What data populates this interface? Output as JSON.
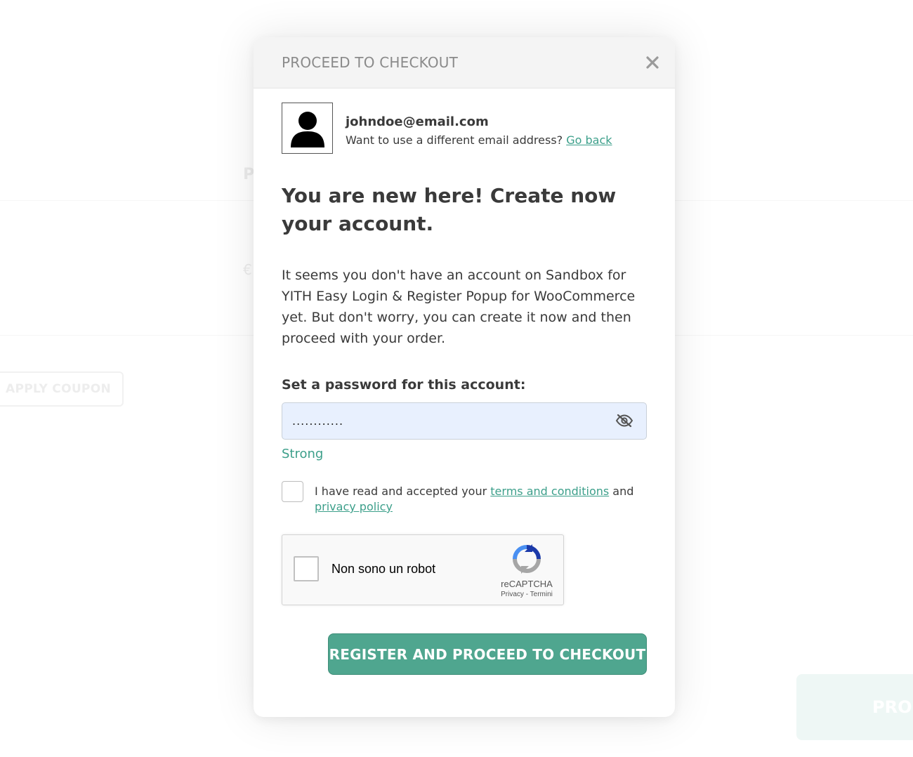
{
  "background": {
    "letter_p": "P",
    "currency_symbol": "€",
    "apply_coupon_label": "APPLY COUPON",
    "proceed_partial_label": "PRO"
  },
  "modal": {
    "title": "PROCEED TO CHECKOUT",
    "close_icon": "close-icon",
    "user": {
      "avatar_icon": "user-avatar-icon",
      "email": "johndoe@email.com",
      "alt_prompt": "Want to use a different email address?",
      "go_back_label": "Go back"
    },
    "headline": "You are new here! Create now your account.",
    "description": "It seems you don't have an account on Sandbox for YITH Easy Login & Register Popup for WooCommerce yet. But don't worry, you can create it now and then proceed with your order.",
    "password": {
      "label": "Set a password for this account:",
      "value": "............",
      "toggle_icon": "eye-slash-icon",
      "strength": "Strong"
    },
    "terms": {
      "prefix": "I have read and accepted your",
      "terms_link": "terms and conditions",
      "and_word": "and",
      "privacy_link": "privacy policy",
      "checked": false
    },
    "captcha": {
      "label": "Non sono un robot",
      "brand": "reCAPTCHA",
      "privacy_link": "Privacy",
      "separator": " - ",
      "terms_link": "Termini",
      "logo_icon": "recaptcha-logo-icon"
    },
    "submit_label": "REGISTER AND PROCEED TO CHECKOUT"
  },
  "colors": {
    "accent": "#4fa68f",
    "link": "#3c9f8a",
    "input_bg": "#e8f0fe",
    "header_bg": "#f4f4f4"
  }
}
